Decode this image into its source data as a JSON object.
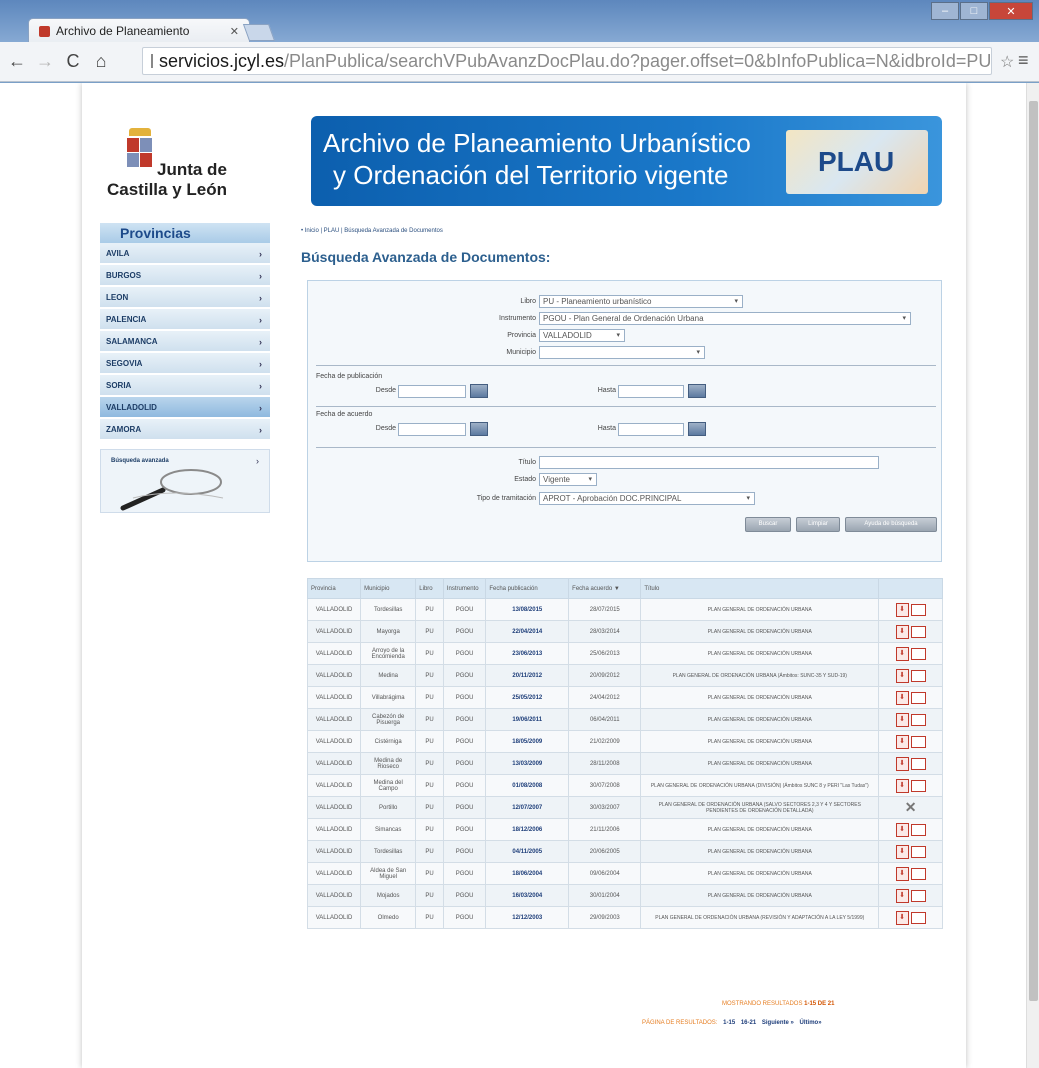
{
  "browser": {
    "tab_title": "Archivo de Planeamiento",
    "url_host": "servicios.jcyl.es",
    "url_path": "/PlanPublica/searchVPubAvanzDocPlau.do?pager.offset=0&bInfoPublica=N&idbroId=PU&in"
  },
  "logo": {
    "line1": "Junta de",
    "line2": "Castilla y León"
  },
  "banner": {
    "line1": "Archivo de Planeamiento Urbanístico",
    "line2": "y Ordenación del Territorio vigente",
    "badge": "PLAU"
  },
  "sidebar": {
    "title": "Provincias",
    "items": [
      {
        "label": "AVILA"
      },
      {
        "label": "BURGOS"
      },
      {
        "label": "LEON"
      },
      {
        "label": "PALENCIA"
      },
      {
        "label": "SALAMANCA"
      },
      {
        "label": "SEGOVIA"
      },
      {
        "label": "SORIA"
      },
      {
        "label": "VALLADOLID"
      },
      {
        "label": "ZAMORA"
      }
    ],
    "advanced_search": "Búsqueda avanzada"
  },
  "breadcrumb": "• Inicio | PLAU | Búsqueda Avanzada de Documentos",
  "page_title": "Búsqueda Avanzada de Documentos:",
  "form": {
    "libro_label": "Libro",
    "libro_value": "PU - Planeamiento urbanístico",
    "instrumento_label": "Instrumento",
    "instrumento_value": "PGOU - Plan General de Ordenación Urbana",
    "provincia_label": "Provincia",
    "provincia_value": "VALLADOLID",
    "municipio_label": "Municipio",
    "municipio_value": "",
    "fecha_pub_label": "Fecha de publicación",
    "fecha_acuerdo_label": "Fecha de acuerdo",
    "desde_label": "Desde",
    "hasta_label": "Hasta",
    "titulo_label": "Título",
    "titulo_value": "",
    "estado_label": "Estado",
    "estado_value": "Vigente",
    "tipo_label": "Tipo de tramitación",
    "tipo_value": "APROT - Aprobación DOC.PRINCIPAL",
    "buscar_label": "Buscar",
    "limpiar_label": "Limpiar",
    "ayuda_label": "Ayuda de búsqueda"
  },
  "table": {
    "headers": [
      "Provincia",
      "Municipio",
      "Libro",
      "Instrumento",
      "Fecha publicación",
      "Fecha acuerdo ▼",
      "Título",
      ""
    ],
    "rows": [
      {
        "provincia": "VALLADOLID",
        "municipio": "Tordesillas",
        "libro": "PU",
        "instrumento": "PGOU",
        "fpub": "13/08/2015",
        "facu": "28/07/2015",
        "titulo": "PLAN GENERAL DE ORDENACIÓN URBANA",
        "icons": "pdf"
      },
      {
        "provincia": "VALLADOLID",
        "municipio": "Mayorga",
        "libro": "PU",
        "instrumento": "PGOU",
        "fpub": "22/04/2014",
        "facu": "28/03/2014",
        "titulo": "PLAN GENERAL DE ORDENACIÓN URBANA",
        "icons": "pdf"
      },
      {
        "provincia": "VALLADOLID",
        "municipio": "Arroyo de la Encomienda",
        "libro": "PU",
        "instrumento": "PGOU",
        "fpub": "23/06/2013",
        "facu": "25/06/2013",
        "titulo": "PLAN GENERAL DE ORDENACIÓN URBANA",
        "icons": "pdf"
      },
      {
        "provincia": "VALLADOLID",
        "municipio": "Medina",
        "libro": "PU",
        "instrumento": "PGOU",
        "fpub": "20/11/2012",
        "facu": "20/09/2012",
        "titulo": "PLAN GENERAL DE ORDENACIÓN URBANA (Ámbitos: SUNC-35 Y SUD-19)",
        "icons": "pdf"
      },
      {
        "provincia": "VALLADOLID",
        "municipio": "Villabrágima",
        "libro": "PU",
        "instrumento": "PGOU",
        "fpub": "25/05/2012",
        "facu": "24/04/2012",
        "titulo": "PLAN GENERAL DE ORDENACIÓN URBANA",
        "icons": "pdf"
      },
      {
        "provincia": "VALLADOLID",
        "municipio": "Cabezón de Pisuerga",
        "libro": "PU",
        "instrumento": "PGOU",
        "fpub": "19/06/2011",
        "facu": "06/04/2011",
        "titulo": "PLAN GENERAL DE ORDENACIÓN URBANA",
        "icons": "pdf"
      },
      {
        "provincia": "VALLADOLID",
        "municipio": "Cistérniga",
        "libro": "PU",
        "instrumento": "PGOU",
        "fpub": "18/05/2009",
        "facu": "21/02/2009",
        "titulo": "PLAN GENERAL DE ORDENACIÓN URBANA",
        "icons": "pdf"
      },
      {
        "provincia": "VALLADOLID",
        "municipio": "Medina de Rioseco",
        "libro": "PU",
        "instrumento": "PGOU",
        "fpub": "13/03/2009",
        "facu": "28/11/2008",
        "titulo": "PLAN GENERAL DE ORDENACIÓN URBANA",
        "icons": "pdf"
      },
      {
        "provincia": "VALLADOLID",
        "municipio": "Medina del Campo",
        "libro": "PU",
        "instrumento": "PGOU",
        "fpub": "01/08/2008",
        "facu": "30/07/2008",
        "titulo": "PLAN GENERAL DE ORDENACIÓN URBANA (DIVISIÓN) (Ámbitos SUNC 8 y PERI \"Las Tudas\")",
        "icons": "pdf"
      },
      {
        "provincia": "VALLADOLID",
        "municipio": "Portillo",
        "libro": "PU",
        "instrumento": "PGOU",
        "fpub": "12/07/2007",
        "facu": "30/03/2007",
        "titulo": "PLAN GENERAL DE ORDENACIÓN URBANA (SALVO SECTORES 2,3 Y 4 Y SECTORES PENDIENTES DE ORDENACIÓN DETALLADA)",
        "icons": "x"
      },
      {
        "provincia": "VALLADOLID",
        "municipio": "Simancas",
        "libro": "PU",
        "instrumento": "PGOU",
        "fpub": "18/12/2006",
        "facu": "21/11/2006",
        "titulo": "PLAN GENERAL DE ORDENACIÓN URBANA",
        "icons": "pdf"
      },
      {
        "provincia": "VALLADOLID",
        "municipio": "Tordesillas",
        "libro": "PU",
        "instrumento": "PGOU",
        "fpub": "04/11/2005",
        "facu": "20/06/2005",
        "titulo": "PLAN GENERAL DE ORDENACIÓN URBANA",
        "icons": "pdf"
      },
      {
        "provincia": "VALLADOLID",
        "municipio": "Aldea de San Miguel",
        "libro": "PU",
        "instrumento": "PGOU",
        "fpub": "18/06/2004",
        "facu": "09/06/2004",
        "titulo": "PLAN GENERAL DE ORDENACIÓN URBANA",
        "icons": "pdf"
      },
      {
        "provincia": "VALLADOLID",
        "municipio": "Mojados",
        "libro": "PU",
        "instrumento": "PGOU",
        "fpub": "16/03/2004",
        "facu": "30/01/2004",
        "titulo": "PLAN GENERAL DE ORDENACIÓN URBANA",
        "icons": "pdf"
      },
      {
        "provincia": "VALLADOLID",
        "municipio": "Olmedo",
        "libro": "PU",
        "instrumento": "PGOU",
        "fpub": "12/12/2003",
        "facu": "29/09/2003",
        "titulo": "PLAN GENERAL DE ORDENACIÓN URBANA (REVISIÓN Y ADAPTACIÓN A LA LEY 5/1999)",
        "icons": "pdf"
      }
    ]
  },
  "summary": {
    "label": "MOSTRANDO RESULTADOS",
    "value": "1-15 DE 21"
  },
  "pager": {
    "label": "PÁGINA DE RESULTADOS:",
    "p1": "1-15",
    "p2": "16-21",
    "next": "Siguiente »",
    "last": "Último»"
  }
}
